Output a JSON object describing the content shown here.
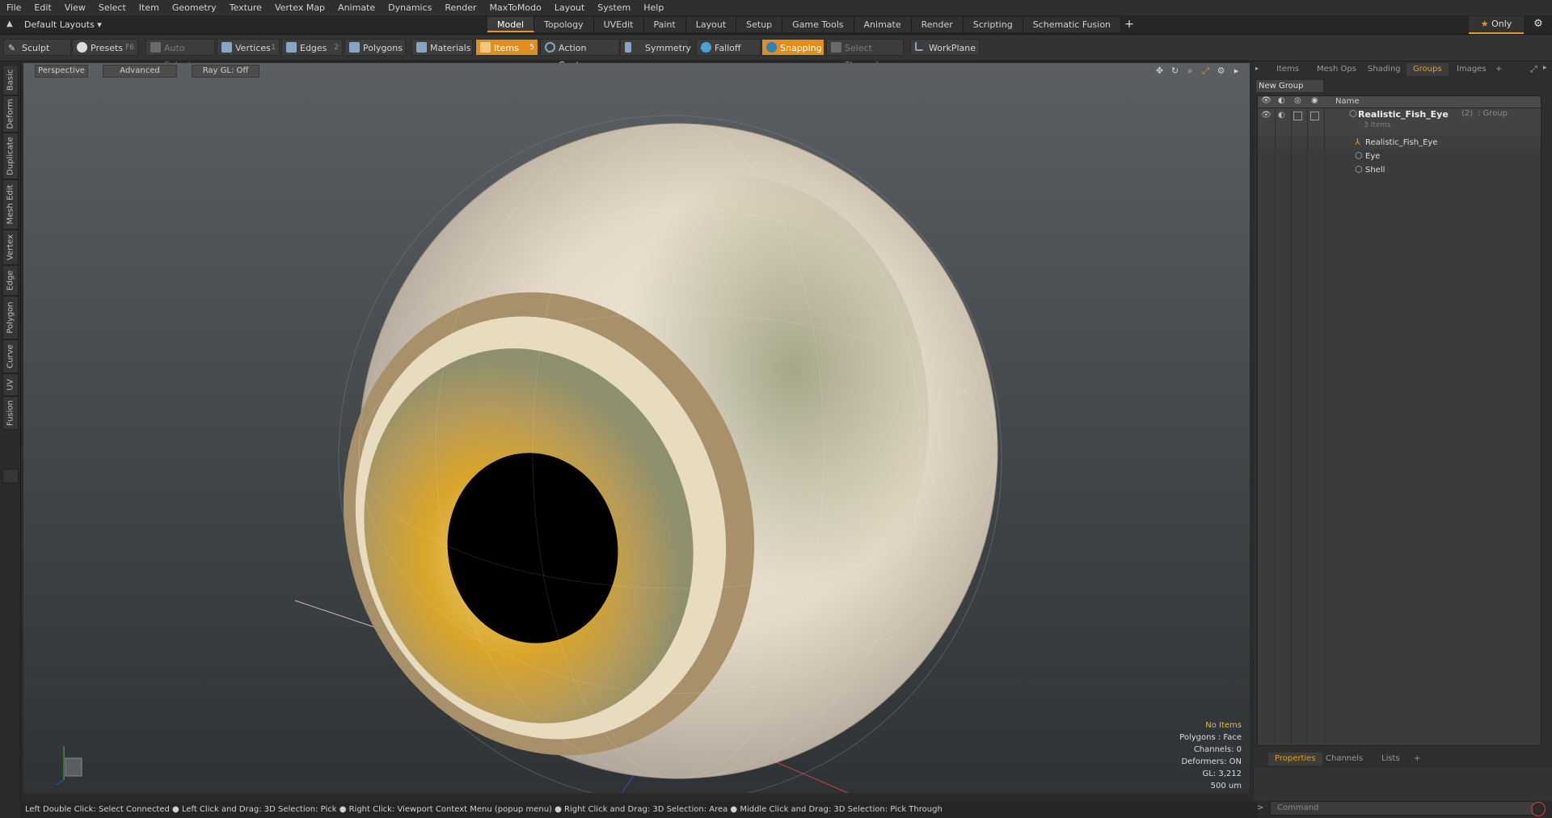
{
  "menu": [
    "File",
    "Edit",
    "View",
    "Select",
    "Item",
    "Geometry",
    "Texture",
    "Vertex Map",
    "Animate",
    "Dynamics",
    "Render",
    "MaxToModo",
    "Layout",
    "System",
    "Help"
  ],
  "layout_selector": "Default Layouts ▾",
  "workspace_tabs": [
    "Model",
    "Topology",
    "UVEdit",
    "Paint",
    "Layout",
    "Setup",
    "Game Tools",
    "Animate",
    "Render",
    "Scripting",
    "Schematic Fusion"
  ],
  "workspace_tab_add": "+",
  "only_button": "Only",
  "toolbar": {
    "sculpt": "Sculpt",
    "presets": "Presets",
    "presets_key": "F6",
    "auto_select": "Auto Select",
    "vertices": "Vertices",
    "vertices_key": "1",
    "edges": "Edges",
    "edges_key": "2",
    "polygons": "Polygons",
    "materials": "Materials",
    "items": "Items",
    "items_key": "5",
    "action_center": "Action Center",
    "symmetry": "Symmetry",
    "falloff": "Falloff",
    "snapping": "Snapping",
    "select_through": "Select Through",
    "workplane": "WorkPlane"
  },
  "left_tabs": [
    "Basic",
    "Deform",
    "Duplicate",
    "Mesh Edit",
    "Vertex",
    "Edge",
    "Polygon",
    "Curve",
    "UV",
    "Fusion"
  ],
  "viewport": {
    "view_mode": "Perspective",
    "shading_mode": "Advanced",
    "raygl": "Ray GL: Off",
    "stats": [
      "No Items",
      "Polygons : Face",
      "Channels: 0",
      "Deformers: ON",
      "GL: 3,212",
      "500 um"
    ]
  },
  "right_panel": {
    "tabs": [
      "Items",
      "Mesh Ops",
      "Shading",
      "Groups",
      "Images"
    ],
    "tab_add": "+",
    "new_group": "New Group",
    "column_name": "Name",
    "tree": {
      "group_name": "Realistic_Fish_Eye",
      "group_count": "(2)",
      "group_type": ": Group",
      "group_items": "3 Items",
      "children": [
        "Realistic_Fish_Eye",
        "Eye",
        "Shell"
      ]
    },
    "bottom_tabs": [
      "Properties",
      "Channels",
      "Lists"
    ],
    "bottom_tab_add": "+"
  },
  "status_bar": "Left Double Click: Select Connected ● Left Click and Drag: 3D Selection: Pick ● Right Click: Viewport Context Menu (popup menu) ● Right Click and Drag: 3D Selection: Area ● Middle Click and Drag: 3D Selection: Pick Through",
  "command_placeholder": "Command",
  "colors": {
    "accent": "#e39a24",
    "eye_pupil": "#000000",
    "iris_gold": "#d9a52a"
  }
}
